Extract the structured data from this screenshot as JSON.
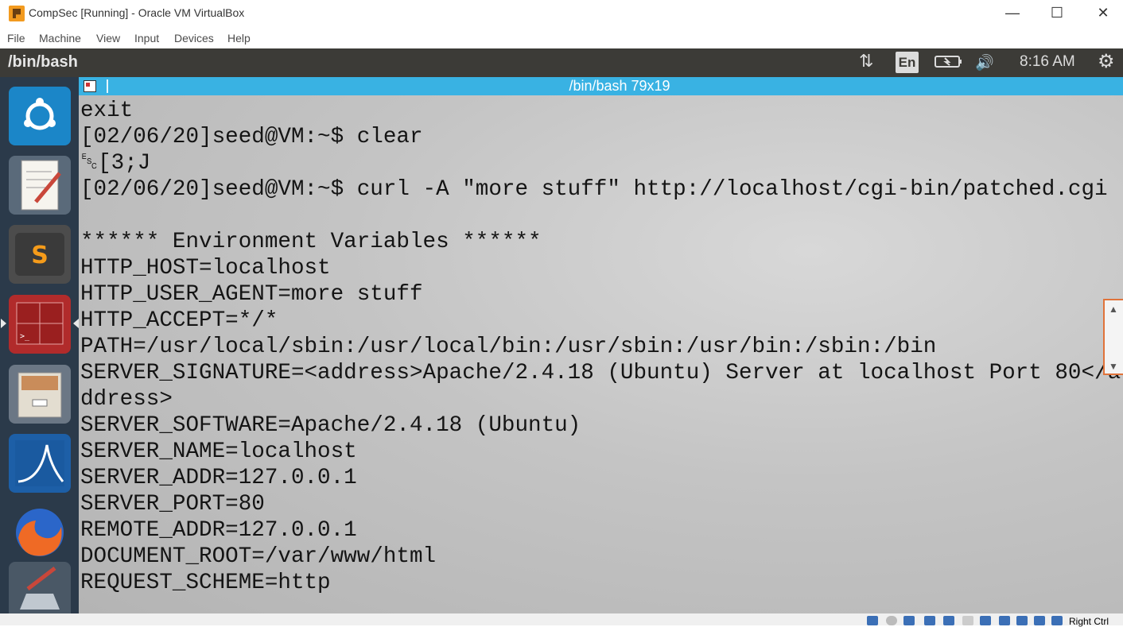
{
  "window": {
    "title": "CompSec [Running] - Oracle VM VirtualBox",
    "minimize": "—",
    "maximize": "☐",
    "close": "✕"
  },
  "menu": [
    "File",
    "Machine",
    "View",
    "Input",
    "Devices",
    "Help"
  ],
  "panel": {
    "title": "/bin/bash",
    "keyboard": "En",
    "time": "8:16 AM"
  },
  "terminal": {
    "title": "/bin/bash 79x19",
    "lines": [
      "exit",
      "[02/06/20]seed@VM:~$ clear",
      "␛[3;J",
      "[02/06/20]seed@VM:~$ curl -A \"more stuff\" http://localhost/cgi-bin/patched.cgi",
      "",
      "****** Environment Variables ******",
      "HTTP_HOST=localhost",
      "HTTP_USER_AGENT=more stuff",
      "HTTP_ACCEPT=*/*",
      "PATH=/usr/local/sbin:/usr/local/bin:/usr/sbin:/usr/bin:/sbin:/bin",
      "SERVER_SIGNATURE=<address>Apache/2.4.18 (Ubuntu) Server at localhost Port 80</a",
      "ddress>",
      "SERVER_SOFTWARE=Apache/2.4.18 (Ubuntu)",
      "SERVER_NAME=localhost",
      "SERVER_ADDR=127.0.0.1",
      "SERVER_PORT=80",
      "REMOTE_ADDR=127.0.0.1",
      "DOCUMENT_ROOT=/var/www/html",
      "REQUEST_SCHEME=http"
    ]
  },
  "launcher": [
    {
      "icon": "ubuntu-dash-icon",
      "color": "#1f8fcf"
    },
    {
      "icon": "text-editor-icon",
      "color": "#e9e6dc"
    },
    {
      "icon": "sublime-text-icon",
      "color": "#4a4a4a"
    },
    {
      "icon": "terminal-icon",
      "color": "#b52a2a"
    },
    {
      "icon": "files-icon",
      "color": "#d8d2c4"
    },
    {
      "icon": "wireshark-icon",
      "color": "#1e5fa6"
    },
    {
      "icon": "firefox-icon",
      "color": "#e8682a"
    },
    {
      "icon": "system-settings-icon",
      "color": "#5a6878"
    }
  ],
  "statusbar": {
    "host_key": "Right Ctrl"
  }
}
